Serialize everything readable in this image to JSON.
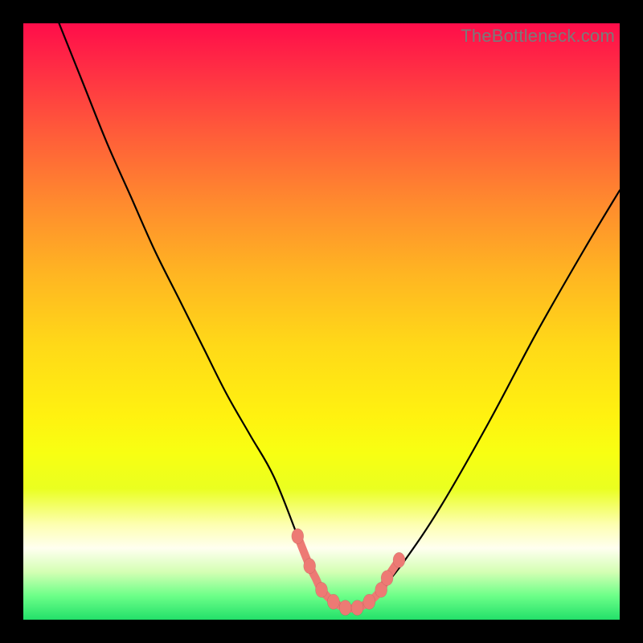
{
  "watermark": "TheBottleneck.com",
  "colors": {
    "frame": "#000000",
    "curve": "#000000",
    "markers": "#ed7a74"
  },
  "chart_data": {
    "type": "line",
    "title": "",
    "xlabel": "",
    "ylabel": "",
    "xlim": [
      0,
      100
    ],
    "ylim": [
      0,
      100
    ],
    "grid": false,
    "legend": false,
    "series": [
      {
        "name": "bottleneck-curve",
        "x": [
          6,
          10,
          14,
          18,
          22,
          26,
          30,
          34,
          38,
          42,
          46,
          48,
          50,
          52,
          54,
          56,
          58,
          60,
          64,
          70,
          78,
          86,
          94,
          100
        ],
        "y": [
          100,
          90,
          80,
          71,
          62,
          54,
          46,
          38,
          31,
          24,
          14,
          9,
          5,
          3,
          2,
          2,
          3,
          5,
          10,
          19,
          33,
          48,
          62,
          72
        ]
      }
    ],
    "markers": {
      "name": "optimal-range",
      "x": [
        46,
        48,
        49,
        50,
        52,
        54,
        56,
        58,
        60,
        61,
        63
      ],
      "y": [
        14,
        9,
        7,
        5,
        3,
        2,
        2,
        3,
        5,
        7,
        10
      ]
    },
    "annotations": []
  }
}
